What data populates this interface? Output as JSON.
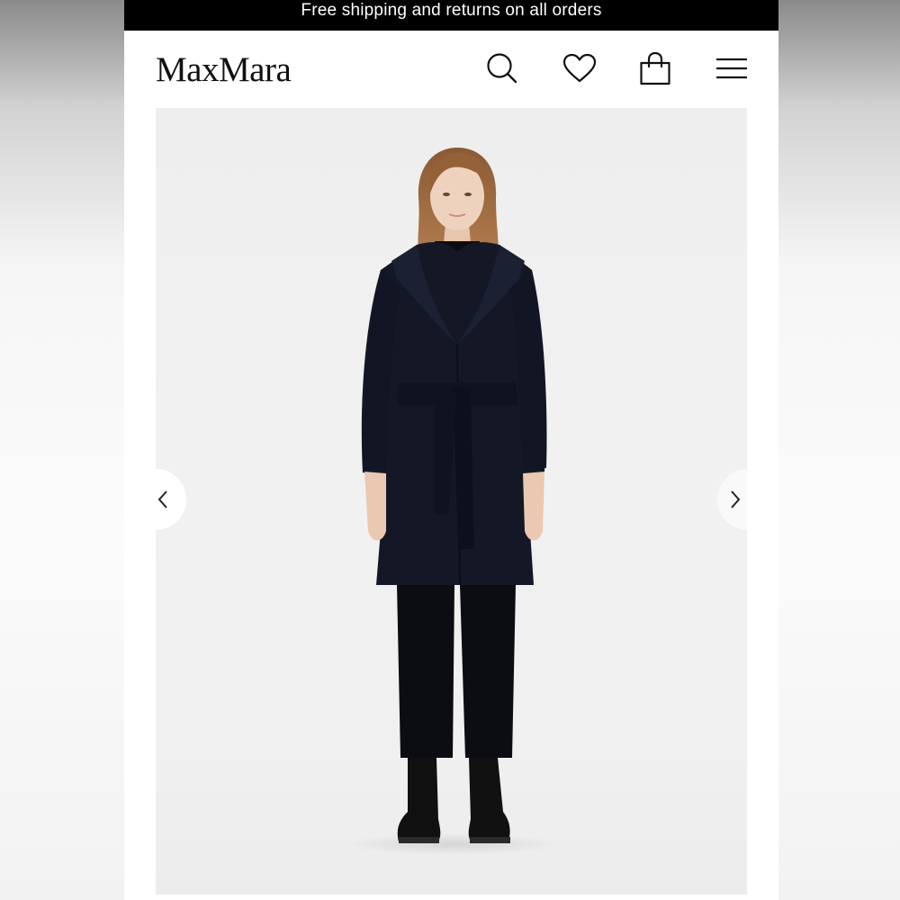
{
  "promo": {
    "text": "Free shipping and returns on all orders"
  },
  "header": {
    "logo": "MaxMara",
    "icons": [
      "search-icon",
      "heart-icon",
      "shopping-bag-icon",
      "hamburger-menu-icon"
    ]
  },
  "gallery": {
    "image": "Model wearing a belted dark navy wrap coat with shawl collar, black cropped trousers and black ankle boots",
    "prev_icon": "chevron-left-icon",
    "next_icon": "chevron-right-icon"
  },
  "colors": {
    "promo_bg": "#000000",
    "promo_text": "#ffffff",
    "coat": "#141826",
    "backdrop": "#efefef"
  }
}
